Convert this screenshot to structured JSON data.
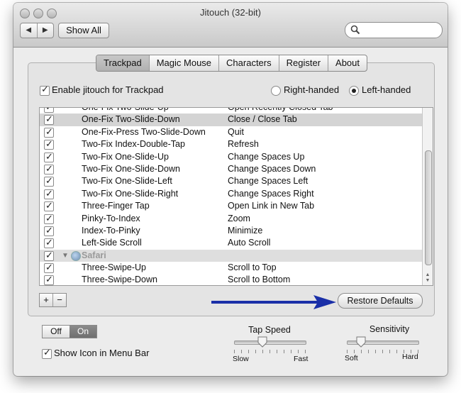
{
  "window": {
    "title": "Jitouch (32-bit)"
  },
  "toolbar": {
    "back": "◀",
    "forward": "▶",
    "show_all": "Show All",
    "search_placeholder": ""
  },
  "tabs": [
    {
      "label": "Trackpad",
      "active": true
    },
    {
      "label": "Magic Mouse",
      "active": false
    },
    {
      "label": "Characters",
      "active": false
    },
    {
      "label": "Register",
      "active": false
    },
    {
      "label": "About",
      "active": false
    }
  ],
  "trackpad": {
    "enable_label": "Enable jitouch for Trackpad",
    "right_handed": "Right-handed",
    "left_handed": "Left-handed",
    "handedness_selected": "Left-handed"
  },
  "gestures": [
    {
      "gesture": "One-Fix Two-Slide-Up",
      "action": "Open Recently Closed Tab"
    },
    {
      "gesture": "One-Fix Two-Slide-Down",
      "action": "Close / Close Tab",
      "selected": true
    },
    {
      "gesture": "One-Fix-Press Two-Slide-Down",
      "action": "Quit"
    },
    {
      "gesture": "Two-Fix Index-Double-Tap",
      "action": "Refresh"
    },
    {
      "gesture": "Two-Fix One-Slide-Up",
      "action": "Change Spaces Up"
    },
    {
      "gesture": "Two-Fix One-Slide-Down",
      "action": "Change Spaces Down"
    },
    {
      "gesture": "Two-Fix One-Slide-Left",
      "action": "Change Spaces Left"
    },
    {
      "gesture": "Two-Fix One-Slide-Right",
      "action": "Change Spaces Right"
    },
    {
      "gesture": "Three-Finger Tap",
      "action": "Open Link in New Tab"
    },
    {
      "gesture": "Pinky-To-Index",
      "action": "Zoom"
    },
    {
      "gesture": "Index-To-Pinky",
      "action": "Minimize"
    },
    {
      "gesture": "Left-Side Scroll",
      "action": "Auto Scroll"
    }
  ],
  "app_group": {
    "name": "Safari"
  },
  "app_gestures": [
    {
      "gesture": "Three-Swipe-Up",
      "action": "Scroll to Top"
    },
    {
      "gesture": "Three-Swipe-Down",
      "action": "Scroll to Bottom"
    }
  ],
  "buttons": {
    "plus": "+",
    "minus": "−",
    "restore_defaults": "Restore Defaults"
  },
  "power": {
    "off": "Off",
    "on": "On",
    "state": "On"
  },
  "show_icon_label": "Show Icon in Menu Bar",
  "tap_speed": {
    "label": "Tap Speed",
    "min_label": "Slow",
    "max_label": "Fast",
    "value": 0.4
  },
  "sensitivity": {
    "label": "Sensitivity",
    "min_label": "Soft",
    "max_label": "Hard",
    "value": 0.2
  },
  "colors": {
    "arrow": "#1a2fa8",
    "selected_row": "#d4d4d4",
    "alt_row": "#eef2f8"
  }
}
